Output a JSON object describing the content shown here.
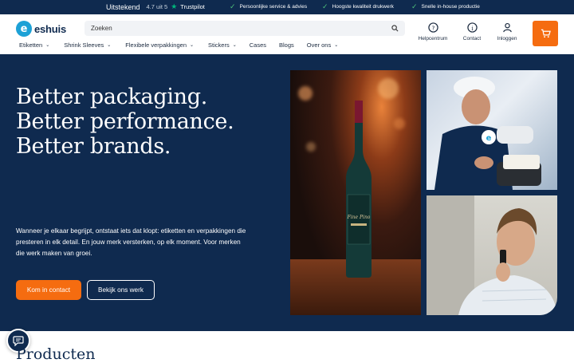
{
  "topbar": {
    "rating_label": "Uitstekend",
    "rating_score": "4.7 uit 5",
    "trustpilot": "Trustpilot",
    "usps": [
      "Persoonlijke service & advies",
      "Hoogste kwaliteit drukwerk",
      "Snelle in-house productie"
    ]
  },
  "header": {
    "logo_text": "eshuis",
    "search_placeholder": "Zoeken",
    "nav": [
      "Etiketten",
      "Shrink Sleeves",
      "Flexibele verpakkingen",
      "Stickers",
      "Cases",
      "Blogs",
      "Over ons"
    ],
    "actions": [
      "Helpcentrum",
      "Contact",
      "Inloggen"
    ]
  },
  "hero": {
    "title_lines": [
      "Better packaging.",
      "Better performance.",
      "Better brands."
    ],
    "body": "Wanneer je elkaar begrijpt, ontstaat iets dat klopt: etiketten en verpakkingen die presteren in elk detail. En jouw merk versterken, op elk moment. Voor merken die werk maken van groei.",
    "primary_cta": "Kom in contact",
    "secondary_cta": "Bekijk ons werk"
  },
  "section": {
    "title": "Producten"
  },
  "colors": {
    "navy": "#0f2a4f",
    "orange": "#f56c10",
    "trustpilot": "#00b67a",
    "check": "#4ec07a"
  }
}
